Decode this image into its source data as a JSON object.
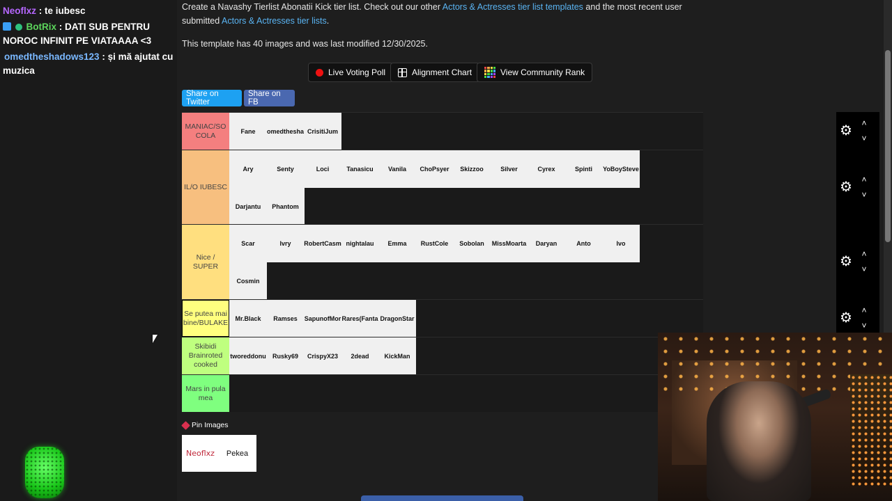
{
  "chat": {
    "messages": [
      {
        "user": "Neoflxz",
        "user_color": "#b667ff",
        "text": "te iubesc",
        "badges": []
      },
      {
        "user": "BotRix",
        "user_color": "#5cd65c",
        "text": "DATI SUB PENTRU NOROC INFINIT PE VIATAAAA <3",
        "badges": [
          "bot-badge-icon",
          "verified-badge-icon"
        ]
      },
      {
        "user": "omedtheshadows123",
        "user_color": "#7ab8ff",
        "text": "și mă ajutat cu muzica",
        "badges": []
      }
    ]
  },
  "page": {
    "description_prefix": "Create a Navashy Tierlist Abonatii Kick tier list. Check out our other ",
    "link1": "Actors & Actresses tier list templates",
    "description_mid": " and the most recent user submitted ",
    "link2": "Actors & Actresses tier lists",
    "description_suffix": ".",
    "meta": "This template has 40 images and was last modified 12/30/2025."
  },
  "buttons": {
    "live_voting": "Live Voting Poll",
    "alignment_chart": "Alignment Chart",
    "community_rank": "View Community Rank",
    "share_twitter": "Share on Twitter",
    "share_fb": "Share on FB"
  },
  "colors": {
    "twitter": "#1da1f2",
    "facebook": "#3b5998",
    "link": "#5ab4f3"
  },
  "tiers": [
    {
      "label": "MANIAC/SO COLA",
      "color": "#f47f7f",
      "items": [
        "Fane",
        "omedthesha",
        "CrisitiJum"
      ]
    },
    {
      "label": "IL/O IUBESC",
      "color": "#f7bf7f",
      "items": [
        "Ary",
        "Senty",
        "Loci",
        "Tanasicu",
        "Vanila",
        "ChoPsyer",
        "Skizzoo",
        "Silver",
        "Cyrex",
        "Spinti",
        "YoBoySteve",
        "Darjantu",
        "Phantom"
      ]
    },
    {
      "label": "Nice / SUPER",
      "color": "#ffdf7f",
      "items": [
        "Scar",
        "Ivry",
        "RobertCasm",
        "nightalau",
        "Emma",
        "RustCole",
        "Sobolan",
        "MissMoarta",
        "Daryan",
        "Anto",
        "Ivo",
        "Cosmin"
      ]
    },
    {
      "label": "Se putea mai bine/BULAKE",
      "color": "#ffff7f",
      "items": [
        "Mr.Black",
        "Ramses",
        "SapunofMor",
        "Rares(Fanta",
        "DragonStar"
      ]
    },
    {
      "label": "Skibidi Brainroted cooked",
      "color": "#bfff7f",
      "items": [
        "tworeddonu",
        "Rusky69",
        "CrispyX23",
        "2dead",
        "KickMan"
      ]
    },
    {
      "label": "Mars in pula mea",
      "color": "#7fff7f",
      "items": []
    }
  ],
  "pin": {
    "label": "Pin Images",
    "items": [
      "Neoflxz",
      "Pekea"
    ]
  }
}
